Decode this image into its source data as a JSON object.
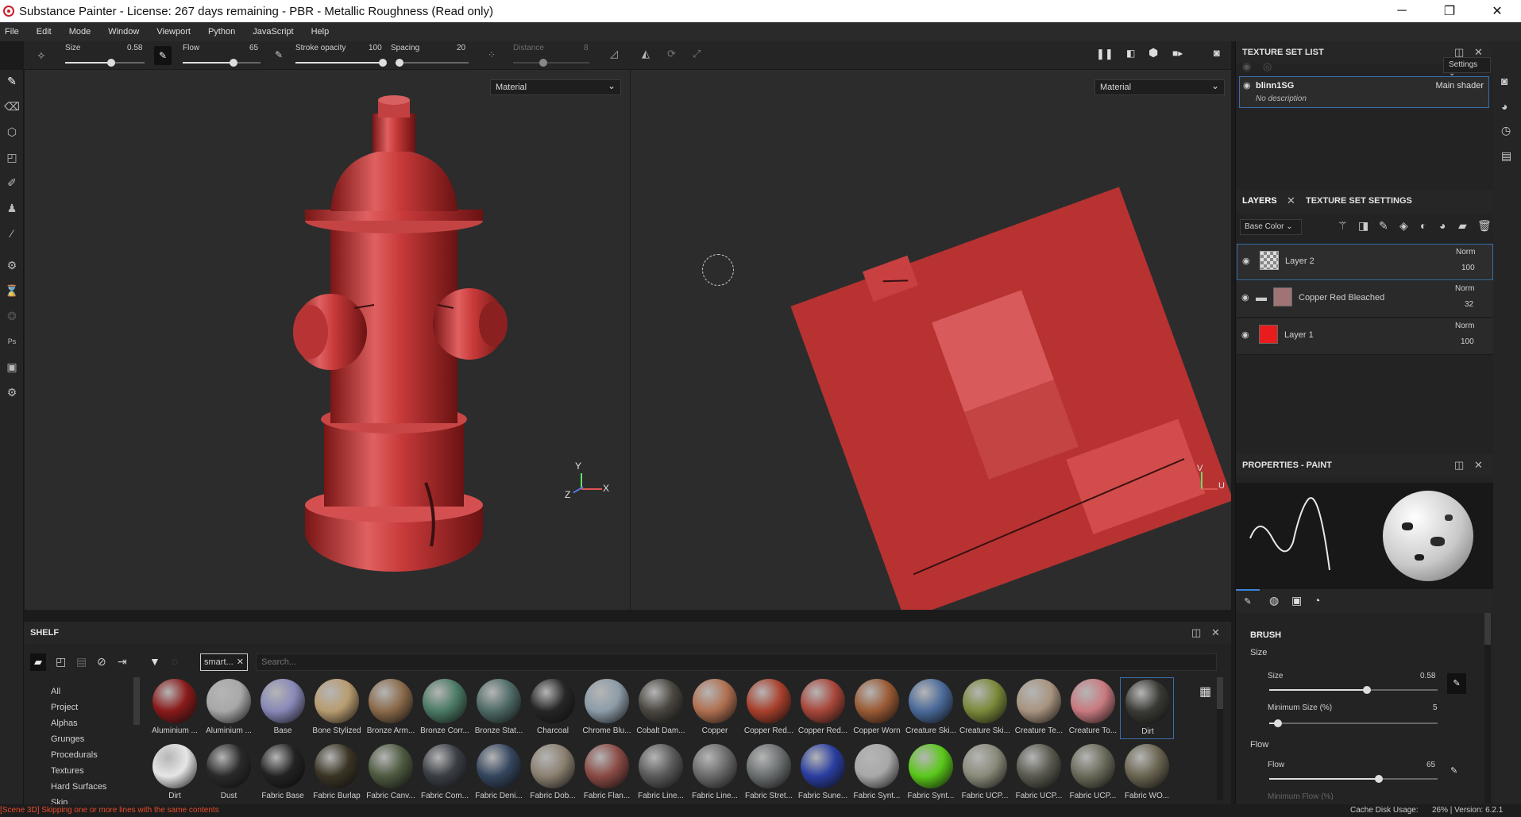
{
  "window": {
    "title": "Substance Painter - License: 267 days remaining - PBR - Metallic Roughness (Read only)",
    "min": "─",
    "max": "❐",
    "close": "✕"
  },
  "menu": [
    "File",
    "Edit",
    "Mode",
    "Window",
    "Viewport",
    "Python",
    "JavaScript",
    "Help"
  ],
  "toolbar": {
    "size_label": "Size",
    "size_value": "0.58",
    "size_level": 0.58,
    "flow_label": "Flow",
    "flow_value": "65",
    "flow_level": 0.65,
    "stroke_label": "Stroke opacity",
    "stroke_value": "100",
    "stroke_level": 1.0,
    "spacing_label": "Spacing",
    "spacing_value": "20",
    "spacing_level": 0.05,
    "distance_label": "Distance",
    "distance_value": "8"
  },
  "viewports": {
    "left_mode": "Material",
    "right_mode": "Material",
    "axis_y": "Y",
    "axis_z": "Z",
    "axis_x": "X",
    "uv_v": "V",
    "uv_u": "U"
  },
  "texture_set_list": {
    "title": "TEXTURE SET LIST",
    "settings": "Settings",
    "set_name": "blinn1SG",
    "shader": "Main shader",
    "description": "No description"
  },
  "layers_panel": {
    "tab_layers": "LAYERS",
    "tab_tss": "TEXTURE SET SETTINGS",
    "channel": "Base Color",
    "layers": [
      {
        "name": "Layer 2",
        "blend": "Norm",
        "opacity": "100",
        "thumb": "checker",
        "folder": false,
        "selected": true
      },
      {
        "name": "Copper Red Bleached",
        "blend": "Norm",
        "opacity": "32",
        "thumb": "#a07474",
        "folder": true,
        "selected": false
      },
      {
        "name": "Layer 1",
        "blend": "Norm",
        "opacity": "100",
        "thumb": "#e81c1c",
        "folder": false,
        "selected": false
      }
    ]
  },
  "properties": {
    "title": "PROPERTIES - PAINT",
    "brush_section": "BRUSH",
    "size_group": "Size",
    "size_label": "Size",
    "size_value": "0.58",
    "size_level": 0.58,
    "minsize_label": "Minimum Size (%)",
    "minsize_value": "5",
    "minsize_level": 0.05,
    "flow_group": "Flow",
    "flow_label": "Flow",
    "flow_value": "65",
    "flow_level": 0.65,
    "minflow_label": "Minimum Flow (%)"
  },
  "shelf": {
    "title": "SHELF",
    "filter_tag": "smart...",
    "search_placeholder": "Search...",
    "categories": [
      "All",
      "Project",
      "Alphas",
      "Grunges",
      "Procedurals",
      "Textures",
      "Hard Surfaces",
      "Skin"
    ],
    "row1": [
      {
        "label": "Aluminium ...",
        "color": "#8a1a1a"
      },
      {
        "label": "Aluminium ...",
        "color": "#a8a8a8"
      },
      {
        "label": "Base",
        "color": "#8888b8"
      },
      {
        "label": "Bone Stylized",
        "color": "#b89c70"
      },
      {
        "label": "Bronze Arm...",
        "color": "#8a6a4a"
      },
      {
        "label": "Bronze Corr...",
        "color": "#4a7a64"
      },
      {
        "label": "Bronze Stat...",
        "color": "#4e6a66"
      },
      {
        "label": "Charcoal",
        "color": "#262626"
      },
      {
        "label": "Chrome Blu...",
        "color": "#8c9ca8"
      },
      {
        "label": "Cobalt Dam...",
        "color": "#4a4640"
      },
      {
        "label": "Copper",
        "color": "#b07050"
      },
      {
        "label": "Copper Red...",
        "color": "#a8402c"
      },
      {
        "label": "Copper Red...",
        "color": "#a8463a"
      },
      {
        "label": "Copper Worn",
        "color": "#9a5a34"
      },
      {
        "label": "Creature Ski...",
        "color": "#4a6a9a"
      },
      {
        "label": "Creature Ski...",
        "color": "#7a8a3a"
      },
      {
        "label": "Creature Te...",
        "color": "#a89480"
      },
      {
        "label": "Creature To...",
        "color": "#c87a80"
      },
      {
        "label": "Dirt",
        "color": "#3a3a34"
      }
    ],
    "row2": [
      {
        "label": "Dirt",
        "color": "#e6e6e6"
      },
      {
        "label": "Dust",
        "color": "#2a2a2a"
      },
      {
        "label": "Fabric Base",
        "color": "#222222"
      },
      {
        "label": "Fabric Burlap",
        "color": "#3a3424"
      },
      {
        "label": "Fabric Canv...",
        "color": "#4e5a40"
      },
      {
        "label": "Fabric Com...",
        "color": "#3a3e44"
      },
      {
        "label": "Fabric Deni...",
        "color": "#34465e"
      },
      {
        "label": "Fabric Dob...",
        "color": "#8a8070"
      },
      {
        "label": "Fabric Flan...",
        "color": "#8a4a44"
      },
      {
        "label": "Fabric Line...",
        "color": "#5a5a5a"
      },
      {
        "label": "Fabric Line...",
        "color": "#6a6a6a"
      },
      {
        "label": "Fabric Stret...",
        "color": "#6a6e70"
      },
      {
        "label": "Fabric Sune...",
        "color": "#2a3ea0"
      },
      {
        "label": "Fabric Synt...",
        "color": "#a8a8a8"
      },
      {
        "label": "Fabric Synt...",
        "color": "#5ac81a"
      },
      {
        "label": "Fabric UCP...",
        "color": "#8a8a7a"
      },
      {
        "label": "Fabric UCP...",
        "color": "#5a5a50"
      },
      {
        "label": "Fabric UCP...",
        "color": "#6a6a5a"
      },
      {
        "label": "Fabric WO...",
        "color": "#6a6450"
      }
    ]
  },
  "status": {
    "message": "[Scene 3D] Skipping one or more lines with the same contents",
    "cache": "Cache Disk Usage:",
    "version": "26% | Version: 6.2.1"
  }
}
